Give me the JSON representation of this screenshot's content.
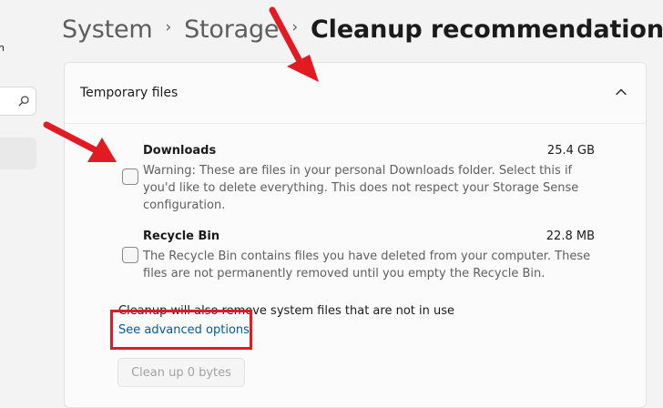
{
  "sidebar": {
    "clipped_label": "n",
    "search_icon": "search-icon"
  },
  "breadcrumb": {
    "items": [
      "System",
      "Storage"
    ],
    "current": "Cleanup recommendations",
    "separator": "›"
  },
  "section": {
    "title": "Temporary files",
    "expanded": true,
    "items": [
      {
        "name": "Downloads",
        "size": "25.4 GB",
        "checked": false,
        "description": "Warning: These are files in your personal Downloads folder. Select this if you'd like to delete everything. This does not respect your Storage Sense configuration."
      },
      {
        "name": "Recycle Bin",
        "size": "22.8 MB",
        "checked": false,
        "description": "The Recycle Bin contains files you have deleted from your computer. These files are not permanently removed until you empty the Recycle Bin."
      }
    ],
    "note": "Cleanup will also remove system files that are not in use",
    "advanced_link": "See advanced options",
    "cleanup_button": "Clean up 0 bytes"
  },
  "colors": {
    "annotation_red": "#e21b23",
    "link_blue": "#005a9e",
    "background": "#f3f3f3"
  }
}
